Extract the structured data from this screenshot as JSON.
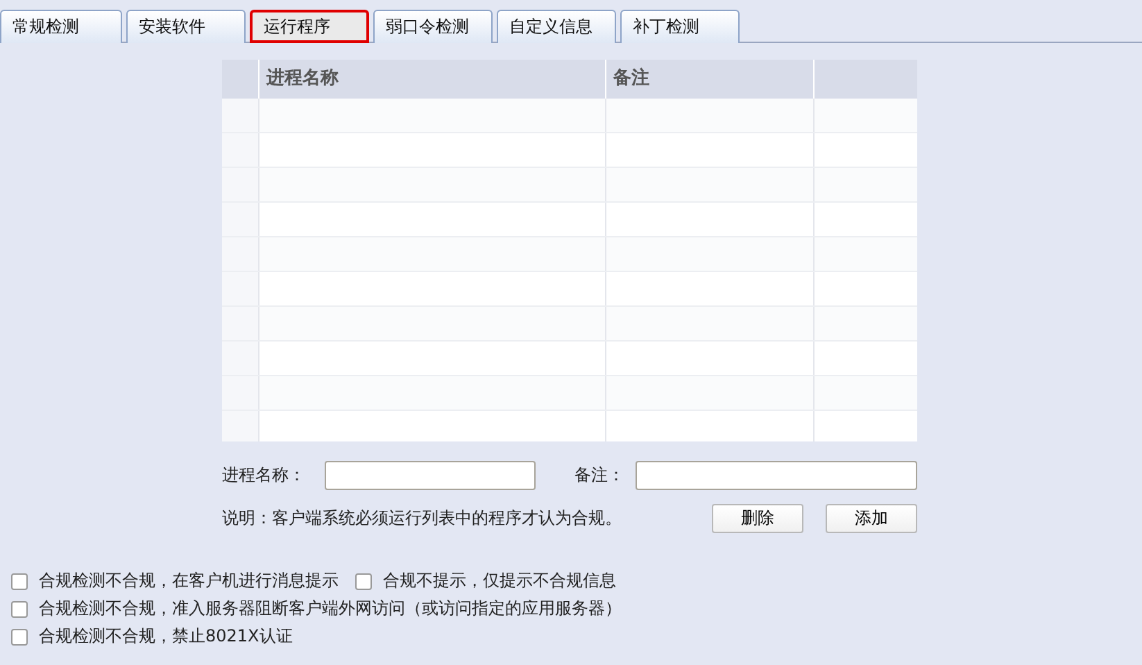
{
  "tabs": [
    {
      "label": "常规检测",
      "selected": false
    },
    {
      "label": "安装软件",
      "selected": false
    },
    {
      "label": "运行程序",
      "selected": true
    },
    {
      "label": "弱口令检测",
      "selected": false
    },
    {
      "label": "自定义信息",
      "selected": false
    },
    {
      "label": "补丁检测",
      "selected": false
    }
  ],
  "table": {
    "columns": [
      "进程名称",
      "备注"
    ]
  },
  "form": {
    "name_label": "进程名称：",
    "note_label": "备注："
  },
  "note": "说明：客户端系统必须运行列表中的程序才认为合规。",
  "buttons": [
    "删除",
    "添加"
  ],
  "option_lines": [
    {
      "options": [
        {
          "label": "合规检测不合规，在客户机进行消息提示",
          "checked": false
        },
        {
          "label": "合规不提示，仅提示不合规信息",
          "checked": false
        }
      ]
    },
    {
      "options": [
        {
          "label": "合规检测不合规，准入服务器阻断客户端外网访问（或访问指定的应用服务器）",
          "checked": false
        }
      ]
    },
    {
      "options": [
        {
          "label": "合规检测不合规，禁止8021X认证",
          "checked": false
        }
      ]
    }
  ]
}
